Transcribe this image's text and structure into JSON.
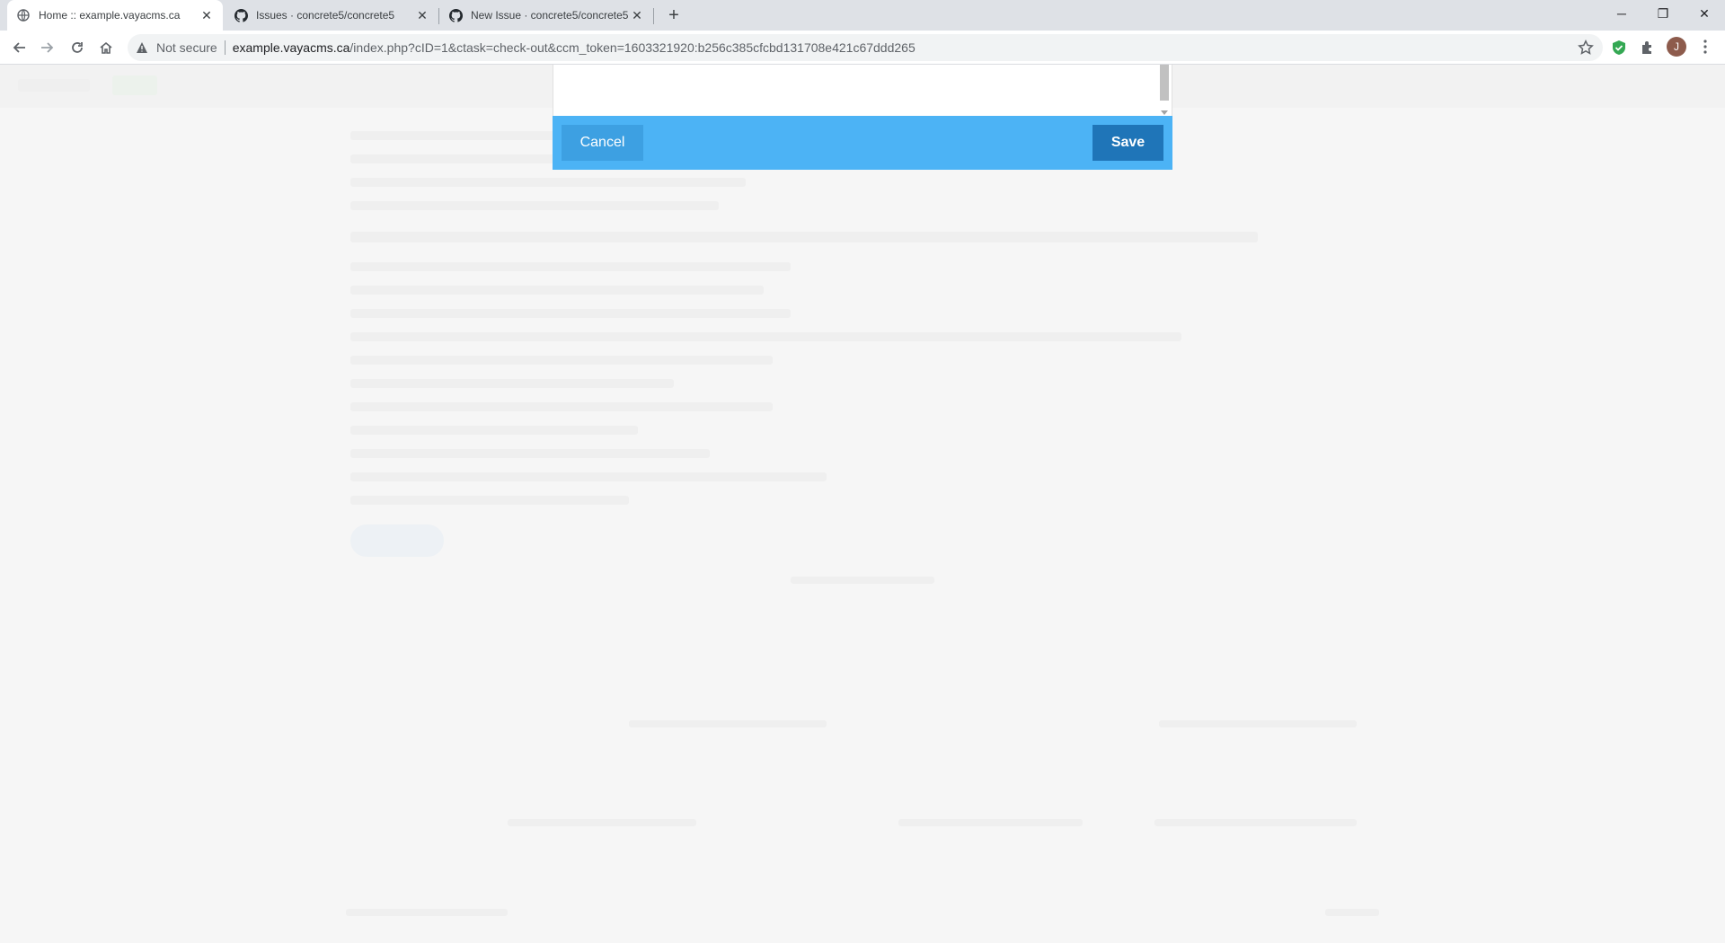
{
  "browser": {
    "tabs": [
      {
        "title": "Home :: example.vayacms.ca",
        "icon": "globe-icon",
        "active": true
      },
      {
        "title": "Issues · concrete5/concrete5",
        "icon": "github-icon",
        "active": false
      },
      {
        "title": "New Issue · concrete5/concrete5",
        "icon": "github-icon",
        "active": false
      }
    ],
    "close_glyph": "✕",
    "new_tab_glyph": "+",
    "window_controls": {
      "minimize": "─",
      "restore": "❐",
      "close": "✕"
    },
    "address": {
      "security_label": "Not secure",
      "host": "example.vayacms.ca",
      "path": "/index.php?cID=1&ctask=check-out&ccm_token=1603321920:b256c385cfcbd131708e421c67ddd265"
    },
    "profile_initial": "J"
  },
  "dialog": {
    "cancel_label": "Cancel",
    "save_label": "Save"
  },
  "colors": {
    "footer": "#4cb3f5",
    "cancel": "#3da0e2",
    "save": "#1f75b8"
  }
}
